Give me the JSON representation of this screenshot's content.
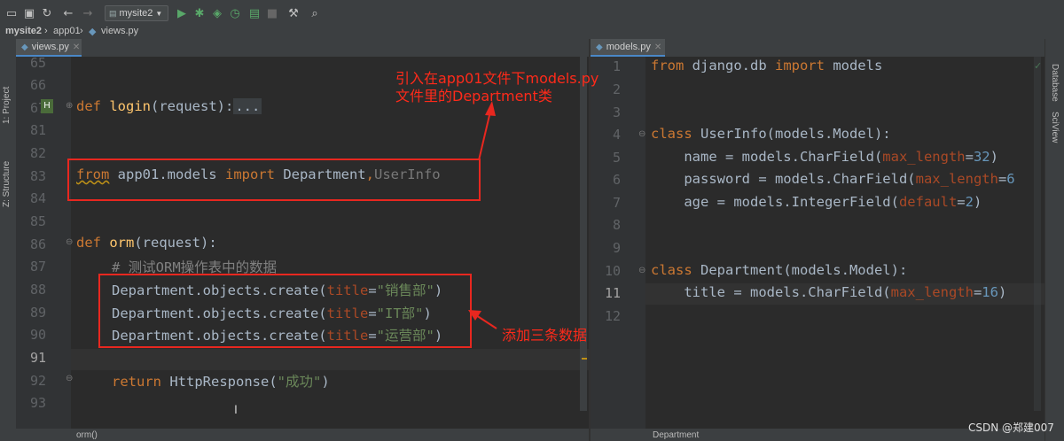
{
  "toolbar": {
    "run_config": "mysite2",
    "icons": [
      "open-icon",
      "save-icon",
      "sync-icon",
      "back-icon",
      "forward-icon",
      "run-icon",
      "debug-icon",
      "coverage-icon",
      "profile-icon",
      "build-icon",
      "stop-icon",
      "settings-wrench-icon",
      "search-icon"
    ]
  },
  "breadcrumbs": {
    "project": "mysite2",
    "folder": "app01",
    "file": "views.py"
  },
  "left_panel": {
    "project_label": "1: Project",
    "structure_label": "Z: Structure"
  },
  "right_panel": {
    "database_label": "Database",
    "sciview_label": "SciView"
  },
  "left_editor": {
    "tab_label": "views.py",
    "line_numbers": [
      "65",
      "66",
      "67",
      "81",
      "82",
      "83",
      "84",
      "85",
      "86",
      "87",
      "88",
      "89",
      "90",
      "91",
      "92",
      "93"
    ],
    "current_line": "91",
    "code": {
      "l67_def": "def ",
      "l67_name": "login",
      "l67_rest": "(request):",
      "l67_fold": "...",
      "l83_from": "from",
      "l83_mod": " app01.models ",
      "l83_import": "import",
      "l83_cls": " Department",
      "l83_comma": ",",
      "l83_unused": "UserInfo",
      "l86_def": "def ",
      "l86_name": "orm",
      "l86_rest": "(request):",
      "l87_comment": "# 测试ORM操作表中的数据",
      "l88_a": "Department.objects.create(",
      "l88_p": "title",
      "l88_eq": "=",
      "l88_s": "\"销售部\"",
      "l88_c": ")",
      "l89_a": "Department.objects.create(",
      "l89_p": "title",
      "l89_eq": "=",
      "l89_s": "\"IT部\"",
      "l89_c": ")",
      "l90_a": "Department.objects.create(",
      "l90_p": "title",
      "l90_eq": "=",
      "l90_s": "\"运营部\"",
      "l90_c": ")",
      "l92_ret": "return",
      "l92_rest": " HttpResponse(",
      "l92_s": "\"成功\"",
      "l92_c": ")"
    },
    "status_text": "orm()"
  },
  "right_editor": {
    "tab_label": "models.py",
    "line_numbers": [
      "1",
      "2",
      "3",
      "4",
      "5",
      "6",
      "7",
      "8",
      "9",
      "10",
      "11",
      "12"
    ],
    "current_line": "11",
    "code": {
      "l1_from": "from",
      "l1_mod": " django.db ",
      "l1_import": "import",
      "l1_rest": " models",
      "l4_class": "class",
      "l4_rest": " UserInfo(models.Model):",
      "l5_a": "    name = models.CharField(",
      "l5_p": "max_length",
      "l5_eq": "=",
      "l5_n": "32",
      "l5_c": ")",
      "l6_a": "    password = models.CharField(",
      "l6_p": "max_length",
      "l6_eq": "=",
      "l6_n": "6",
      "l7_a": "    age = models.IntegerField(",
      "l7_p": "default",
      "l7_eq": "=",
      "l7_n": "2",
      "l7_c": ")",
      "l10_class": "class",
      "l10_rest": " Department(models.Model):",
      "l11_a": "    title = models.CharField(",
      "l11_p": "max_length",
      "l11_eq": "=",
      "l11_n": "16",
      "l11_c": ")"
    },
    "status_text": "Department"
  },
  "annotations": {
    "import_note_line1": "引入在app01文件下models.py",
    "import_note_line2": "文件里的Department类",
    "add_note": "添加三条数据"
  },
  "watermark": "CSDN @郑建007",
  "colors": {
    "annotation_red": "#e8271f",
    "keyword": "#cc7832",
    "string": "#6a8759",
    "param": "#aa4926",
    "number": "#6897bb",
    "function": "#ffc66d"
  }
}
